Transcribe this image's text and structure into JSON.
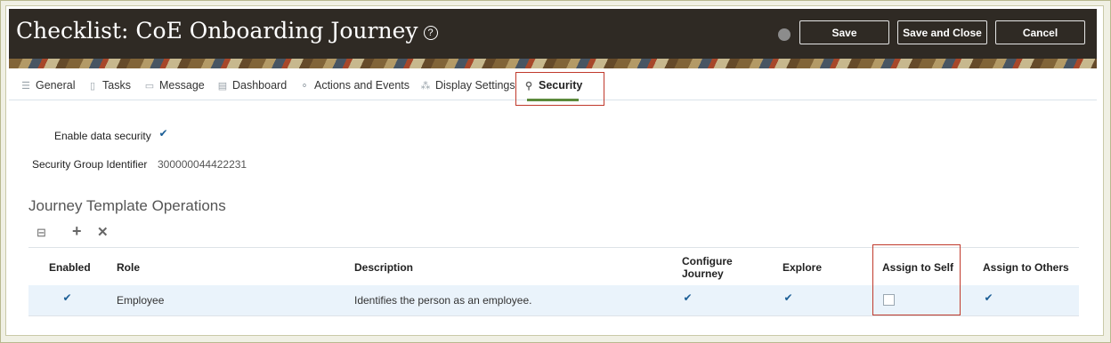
{
  "header": {
    "title": "Checklist: CoE Onboarding Journey",
    "help_glyph": "?",
    "buttons": {
      "save": "Save",
      "save_close": "Save and Close",
      "cancel": "Cancel"
    }
  },
  "tabs": [
    {
      "label": "General",
      "icon": "list-icon",
      "glyph": "☰"
    },
    {
      "label": "Tasks",
      "icon": "clipboard-icon",
      "glyph": "▯"
    },
    {
      "label": "Message",
      "icon": "message-icon",
      "glyph": "▭"
    },
    {
      "label": "Dashboard",
      "icon": "dashboard-icon",
      "glyph": "▤"
    },
    {
      "label": "Actions and Events",
      "icon": "actions-icon",
      "glyph": "⚬"
    },
    {
      "label": "Display Settings",
      "icon": "display-settings-icon",
      "glyph": "⁂"
    },
    {
      "label": "Security",
      "icon": "security-user-icon",
      "glyph": "⚲"
    }
  ],
  "security": {
    "enable_label": "Enable data security",
    "enable_checked": true,
    "group_id_label": "Security Group Identifier",
    "group_id_value": "300000044422231"
  },
  "operations": {
    "title": "Journey Template Operations",
    "toolbar": {
      "filter_glyph": "⊟",
      "add_glyph": "+",
      "delete_glyph": "✕"
    },
    "columns": {
      "enabled": "Enabled",
      "role": "Role",
      "description": "Description",
      "configure_line1": "Configure",
      "configure_line2": "Journey",
      "explore": "Explore",
      "assign_self": "Assign to Self",
      "assign_others": "Assign to Others"
    },
    "rows": [
      {
        "enabled": true,
        "role": "Employee",
        "description": "Identifies the person as an employee.",
        "configure": true,
        "explore": true,
        "assign_self": false,
        "assign_others": true
      }
    ]
  },
  "colors": {
    "header_bg": "#2f2a24",
    "active_tab_underline": "#5c8a3c",
    "highlight_box": "#c0392b",
    "row_bg": "#eaf3fb"
  }
}
